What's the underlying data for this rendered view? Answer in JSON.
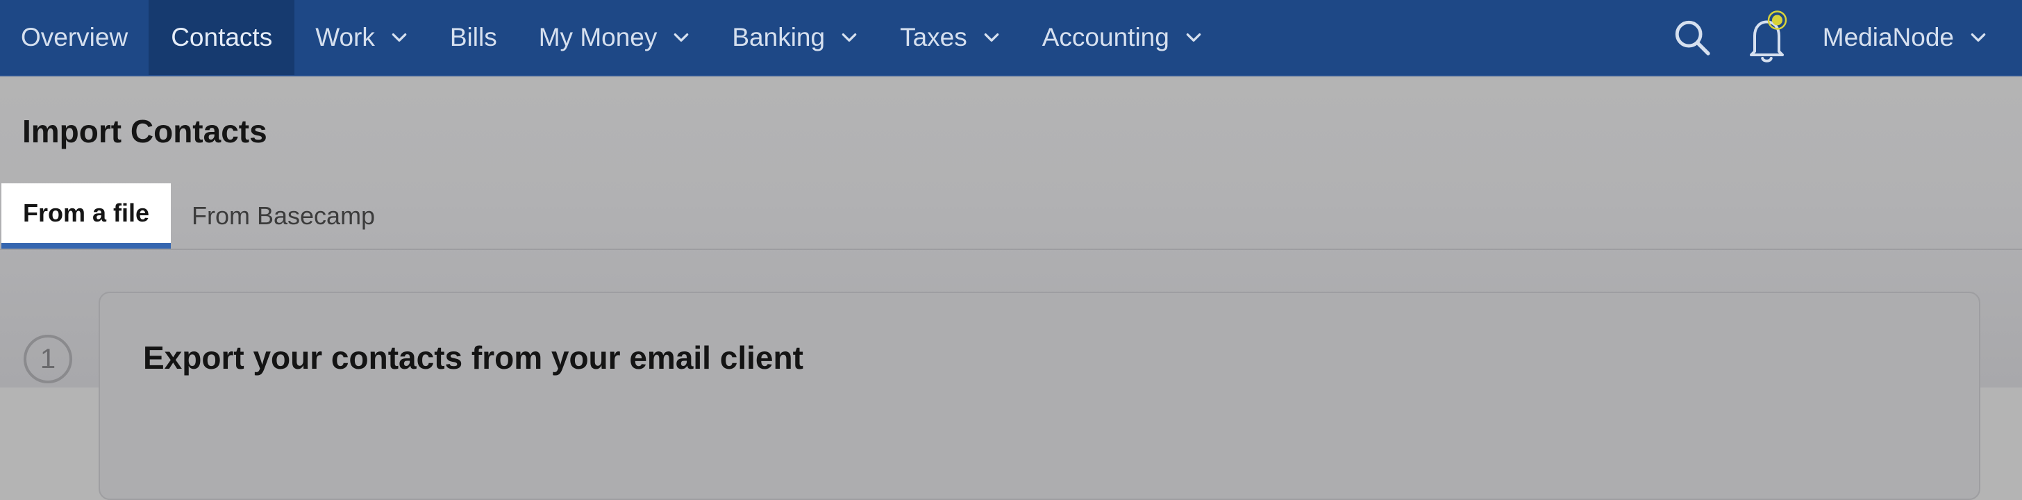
{
  "nav": {
    "items": [
      {
        "label": "Overview",
        "active": false,
        "dropdown": false
      },
      {
        "label": "Contacts",
        "active": true,
        "dropdown": false
      },
      {
        "label": "Work",
        "active": false,
        "dropdown": true
      },
      {
        "label": "Bills",
        "active": false,
        "dropdown": false
      },
      {
        "label": "My Money",
        "active": false,
        "dropdown": true
      },
      {
        "label": "Banking",
        "active": false,
        "dropdown": true
      },
      {
        "label": "Taxes",
        "active": false,
        "dropdown": true
      },
      {
        "label": "Accounting",
        "active": false,
        "dropdown": true
      }
    ],
    "search_icon": "search-icon",
    "notification_icon": "bell-icon",
    "account_name": "MediaNode"
  },
  "page": {
    "title": "Import Contacts",
    "tabs": [
      {
        "label": "From a file",
        "active": true
      },
      {
        "label": "From Basecamp",
        "active": false
      }
    ],
    "step_number": "1",
    "step_title": "Export your contacts from your email client"
  },
  "colors": {
    "nav_bg": "#1e4886",
    "tab_accent": "#3566b0",
    "notification_dot": "#d8d23a"
  }
}
